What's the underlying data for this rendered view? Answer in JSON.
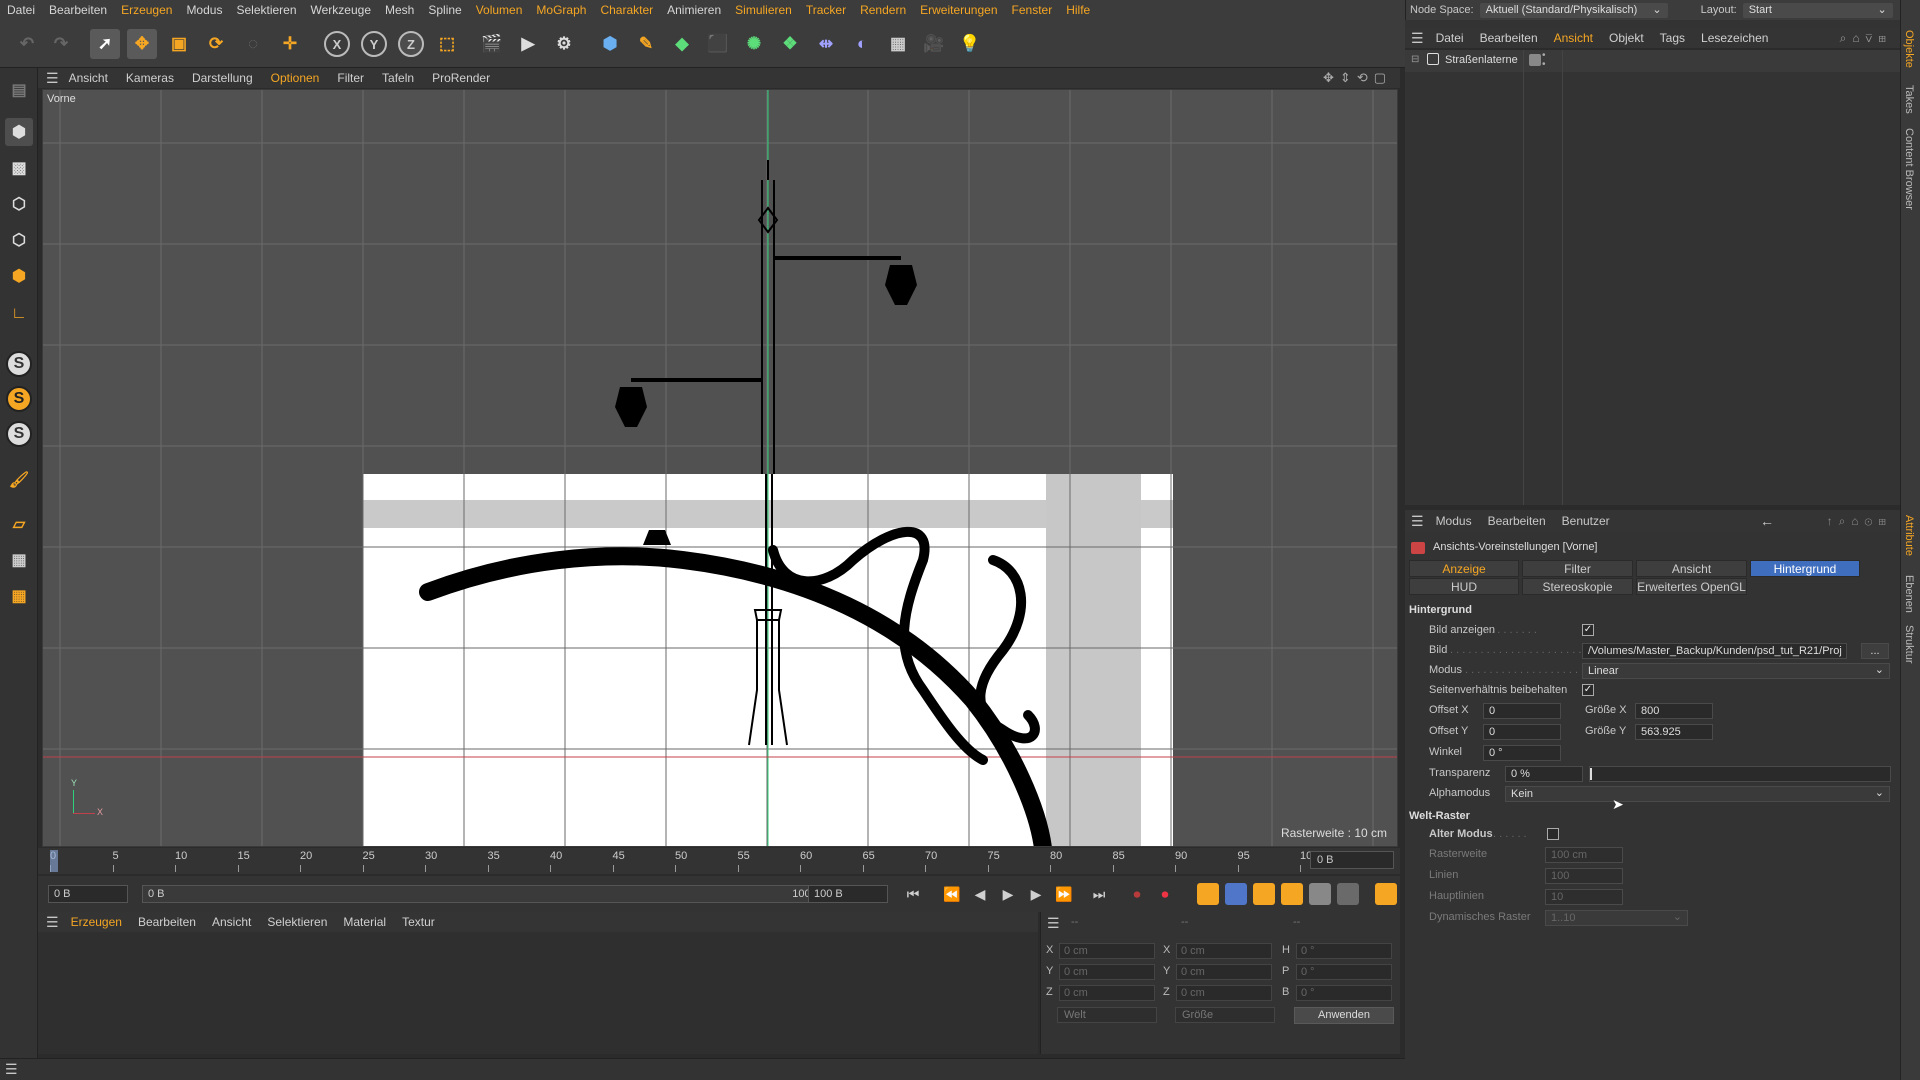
{
  "menubar": {
    "items": [
      "Datei",
      "Bearbeiten",
      "Erzeugen",
      "Modus",
      "Selektieren",
      "Werkzeuge",
      "Mesh",
      "Spline",
      "Volumen",
      "MoGraph",
      "Charakter",
      "Animieren",
      "Simulieren",
      "Tracker",
      "Rendern",
      "Erweiterungen",
      "Fenster",
      "Hilfe"
    ],
    "accent_color": "#f5a623"
  },
  "node_bar": {
    "node_space_label": "Node Space:",
    "node_space_value": "Aktuell (Standard/Physikalisch)",
    "layout_label": "Layout:",
    "layout_value": "Start"
  },
  "toolbar": {
    "icons": [
      "undo-icon",
      "redo-icon",
      "select-icon",
      "move-icon",
      "scale-icon",
      "rotate-icon",
      "live-select-icon",
      "add-icon",
      "axis-x-icon",
      "axis-y-icon",
      "axis-z-icon",
      "coordinate-system-icon",
      "render-region-icon",
      "render-view-icon",
      "render-settings-icon",
      "cube-icon",
      "pen-icon",
      "subdivision-icon",
      "extrude-icon",
      "cloner-icon",
      "mograph-icon",
      "deformer-icon",
      "field-icon",
      "floor-icon",
      "camera-icon",
      "light-icon"
    ],
    "axis_labels": [
      "X",
      "Y",
      "Z"
    ]
  },
  "viewport": {
    "menu": [
      "Ansicht",
      "Kameras",
      "Darstellung",
      "Optionen",
      "Filter",
      "Tafeln",
      "ProRender"
    ],
    "active_menu": "Optionen",
    "view_name": "Vorne",
    "raster_label": "Rasterweite : 10 cm",
    "axis_y": "Y",
    "axis_x": "X"
  },
  "timeline": {
    "ticks": [
      "0",
      "5",
      "10",
      "15",
      "20",
      "25",
      "30",
      "35",
      "40",
      "45",
      "50",
      "55",
      "60",
      "65",
      "70",
      "75",
      "80",
      "85",
      "90",
      "95",
      "100"
    ],
    "current_frame": "0 B"
  },
  "transport": {
    "start_field": "0 B",
    "range_start": "0 B",
    "range_end": "100 B",
    "end_field": "100 B"
  },
  "material_manager": {
    "menu": [
      "Erzeugen",
      "Bearbeiten",
      "Ansicht",
      "Selektieren",
      "Material",
      "Textur"
    ],
    "active_menu": "Erzeugen"
  },
  "coordinates": {
    "header_dashes": [
      "--",
      "--",
      "--"
    ],
    "rows": [
      {
        "pos_label": "X",
        "pos_value": "0 cm",
        "size_label": "X",
        "size_value": "0 cm",
        "rot_label": "H",
        "rot_value": "0 °"
      },
      {
        "pos_label": "Y",
        "pos_value": "0 cm",
        "size_label": "Y",
        "size_value": "0 cm",
        "rot_label": "P",
        "rot_value": "0 °"
      },
      {
        "pos_label": "Z",
        "pos_value": "0 cm",
        "size_label": "Z",
        "size_value": "0 cm",
        "rot_label": "B",
        "rot_value": "0 °"
      }
    ],
    "mode_dropdown": "Welt",
    "size_dropdown": "Größe",
    "apply_button": "Anwenden"
  },
  "object_manager": {
    "menu": [
      "Datei",
      "Bearbeiten",
      "Ansicht",
      "Objekt",
      "Tags",
      "Lesezeichen"
    ],
    "active_menu": "Ansicht",
    "objects": [
      {
        "name": "Straßenlaterne"
      }
    ]
  },
  "attribute_manager": {
    "menu": [
      "Modus",
      "Bearbeiten",
      "Benutzer"
    ],
    "title": "Ansichts-Voreinstellungen [Vorne]",
    "tabs_row1": [
      "Anzeige",
      "Filter",
      "Ansicht",
      "Hintergrund"
    ],
    "tabs_row2": [
      "HUD",
      "Stereoskopie",
      "Erweitertes OpenGL"
    ],
    "active_tab": "Hintergrund",
    "section_background": "Hintergrund",
    "bild_anzeigen_label": "Bild anzeigen",
    "bild_label": "Bild",
    "bild_value": "/Volumes/Master_Backup/Kunden/psd_tut_R21/Proj",
    "bild_button": "...",
    "modus_label": "Modus",
    "modus_value": "Linear",
    "seitenverhaeltnis_label": "Seitenverhältnis beibehalten",
    "offset_x_label": "Offset X",
    "offset_x_value": "0",
    "offset_y_label": "Offset Y",
    "offset_y_value": "0",
    "groesse_x_label": "Größe X",
    "groesse_x_value": "800",
    "groesse_y_label": "Größe Y",
    "groesse_y_value": "563.925",
    "winkel_label": "Winkel",
    "winkel_value": "0 °",
    "transparenz_label": "Transparenz",
    "transparenz_value": "0 %",
    "transparenz_level": 0,
    "alphamodus_label": "Alphamodus",
    "alphamodus_value": "Kein",
    "section_grid": "Welt-Raster",
    "alter_modus_label": "Alter Modus",
    "rasterweite_label": "Rasterweite",
    "rasterweite_value": "100 cm",
    "linien_label": "Linien",
    "linien_value": "100",
    "hauptlinien_label": "Hauptlinien",
    "hauptlinien_value": "10",
    "dyn_raster_label": "Dynamisches Raster",
    "dyn_raster_value": "1..10"
  },
  "side_tabs": [
    "Objekte",
    "Takes",
    "Content Browser",
    "Attribute",
    "Ebenen",
    "Struktur"
  ]
}
